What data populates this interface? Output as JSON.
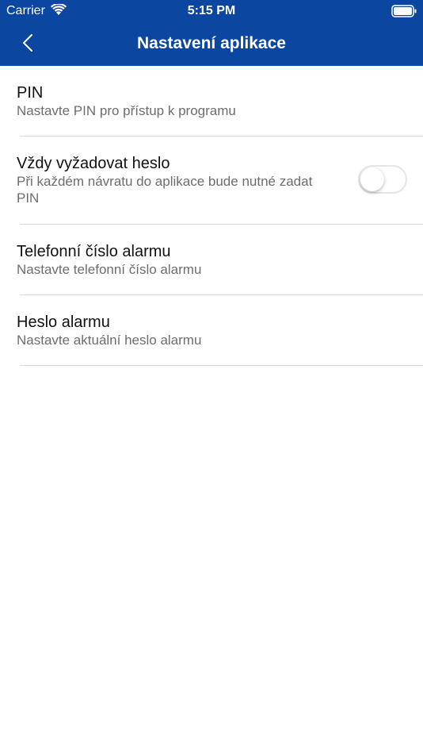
{
  "status_bar": {
    "carrier": "Carrier",
    "time": "5:15 PM",
    "wifi_icon": "wifi-icon",
    "battery_icon": "battery-icon"
  },
  "nav": {
    "title": "Nastavení aplikace",
    "back_icon": "chevron-left-icon"
  },
  "colors": {
    "header_bg": "#0b46a1",
    "header_text": "#ffffff",
    "primary_text": "#111111",
    "secondary_text": "#6d6d6d",
    "divider": "#d9d9d9"
  },
  "settings": [
    {
      "title": "PIN",
      "description": "Nastavte PIN pro přístup k programu"
    },
    {
      "title": "Vždy vyžadovat heslo",
      "description": "Při každém návratu do aplikace bude nutné zadat PIN",
      "toggle_on": false
    },
    {
      "title": "Telefonní číslo alarmu",
      "description": "Nastavte telefonní číslo alarmu"
    },
    {
      "title": "Heslo alarmu",
      "description": "Nastavte aktuální heslo alarmu"
    }
  ]
}
